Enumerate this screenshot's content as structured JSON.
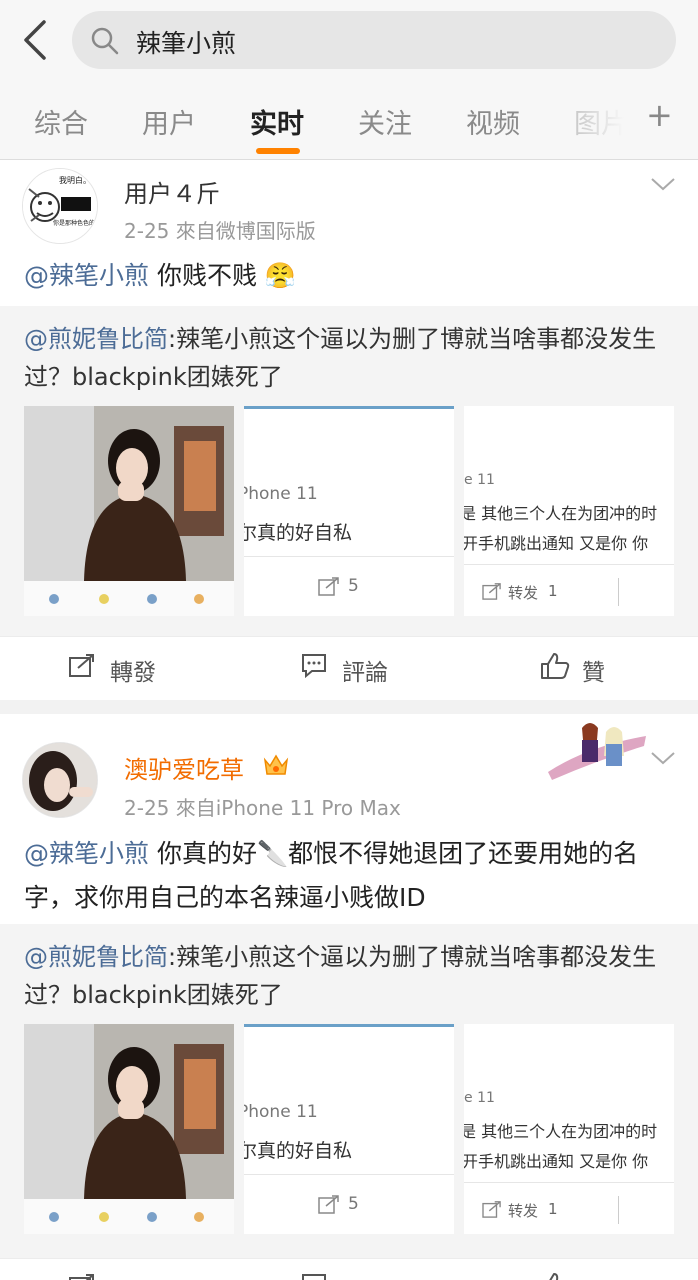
{
  "search": {
    "query": "辣筆小煎"
  },
  "tabs": [
    "综合",
    "用户",
    "实时",
    "关注",
    "视频",
    "图片",
    "+"
  ],
  "posts": [
    {
      "username": "用户４斤",
      "meta": "2-25  來自微博国际版",
      "avatar_text": [
        "我明白。",
        "你是那种色色的人!"
      ],
      "mention": "@辣笔小煎",
      "body": "  你贱不贱",
      "emoji": "😤",
      "repost": {
        "author": "@煎妮鲁比简",
        "text": ":辣笔小煎这个逼以为删了博就当啥事都没发生过？blackpink团婊死了"
      },
      "thumbs": {
        "t2_line1": "Phone 11",
        "t2_line2": "尔真的好自私",
        "t2_count": "5",
        "t3_line1": "e 11",
        "t3_line2": "是 其他三个人在为团冲的时",
        "t3_line3": "开手机跳出通知 又是你 你",
        "t3_forward": "转发",
        "t3_count": "1"
      },
      "actions": {
        "repost": "轉發",
        "comment": "評論",
        "like": "贊"
      }
    },
    {
      "username": "澳驴爱吃草",
      "meta": "2-25  來自iPhone 11 Pro Max",
      "mention": "@辣笔小煎",
      "body": " 你真的好🔪都恨不得她退团了还要用她的名字，求你用自己的本名辣逼小贱做ID",
      "repost": {
        "author": "@煎妮鲁比简",
        "text": ":辣笔小煎这个逼以为删了博就当啥事都没发生过？blackpink团婊死了"
      },
      "thumbs": {
        "t2_line1": "Phone 11",
        "t2_line2": "尔真的好自私",
        "t2_count": "5",
        "t3_line1": "e 11",
        "t3_line2": "是 其他三个人在为团冲的时",
        "t3_line3": "开手机跳出通知 又是你 你",
        "t3_forward": "转发",
        "t3_count": "1"
      },
      "actions": {
        "repost": "轉發",
        "comment": "評論",
        "like": "贊"
      }
    }
  ],
  "colors": {
    "accent": "#ff8200",
    "link": "#4c6c96",
    "vip_name": "#f26c00"
  }
}
